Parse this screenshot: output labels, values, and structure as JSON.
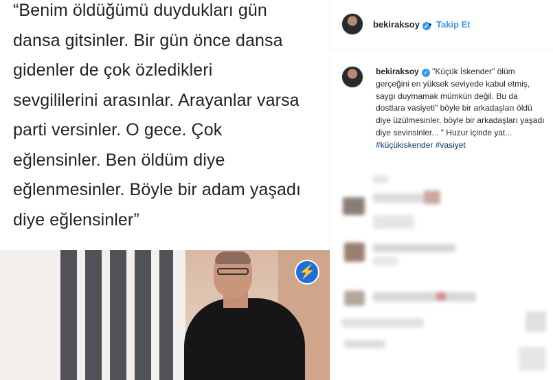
{
  "post": {
    "quote_lines": [
      "“Benim öldüğümü duydukları gün",
      "dansa gitsinler. Bir gün önce dansa",
      "gidenler de çok özledikleri",
      "sevgililerini arasınlar. Arayanlar varsa",
      "parti versinler. O gece. Çok",
      "eğlensinler. Ben öldüm diye",
      "eğlenmesinler. Böyle bir adam yaşadı",
      "diye eğlensinler”"
    ],
    "badge_icon": "lightning-icon"
  },
  "header": {
    "username": "bekiraksoy",
    "verified_icon": "verified-check-icon",
    "separator": "•",
    "follow_label": "Takip Et"
  },
  "caption": {
    "username": "bekiraksoy",
    "text": "\"Küçük İskender\" ölüm gerçeğini en yüksek seviyede kabul etmiş, saygı duymamak mümkün değil. Bu da dostlara vasiyeti\" böyle bir arkadaşları öldü diye üzülmesinler, böyle bir arkadaşları yaşadı diye sevinsinler... \" Huzur içinde yat...",
    "hashtags": "#küçükiskender #vasiyet"
  },
  "colors": {
    "accent": "#3897f0",
    "text": "#262626",
    "hashtag": "#00376b"
  }
}
